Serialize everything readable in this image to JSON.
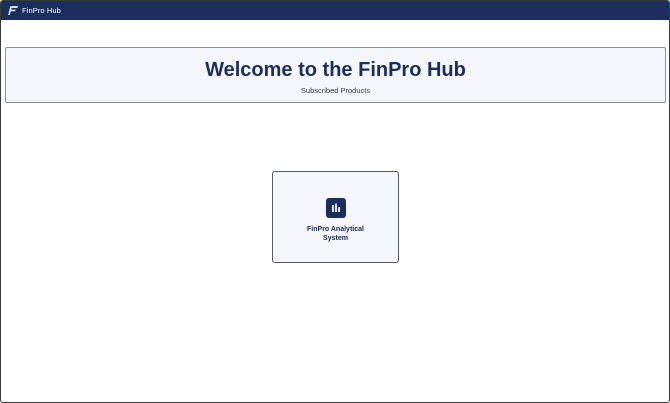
{
  "header": {
    "app_name": "FinPro Hub",
    "logo_icon": "finpro-logo-icon",
    "background_color": "#1b2f5e"
  },
  "hero": {
    "title": "Welcome to the FinPro Hub",
    "subtitle": "Subscribed Products"
  },
  "products": [
    {
      "name": "FinPro Analytical System",
      "icon": "bar-chart-icon",
      "icon_color": "#1b2f5e"
    }
  ],
  "colors": {
    "accent": "#1b2f5e",
    "card_background": "#f4f6fb"
  }
}
